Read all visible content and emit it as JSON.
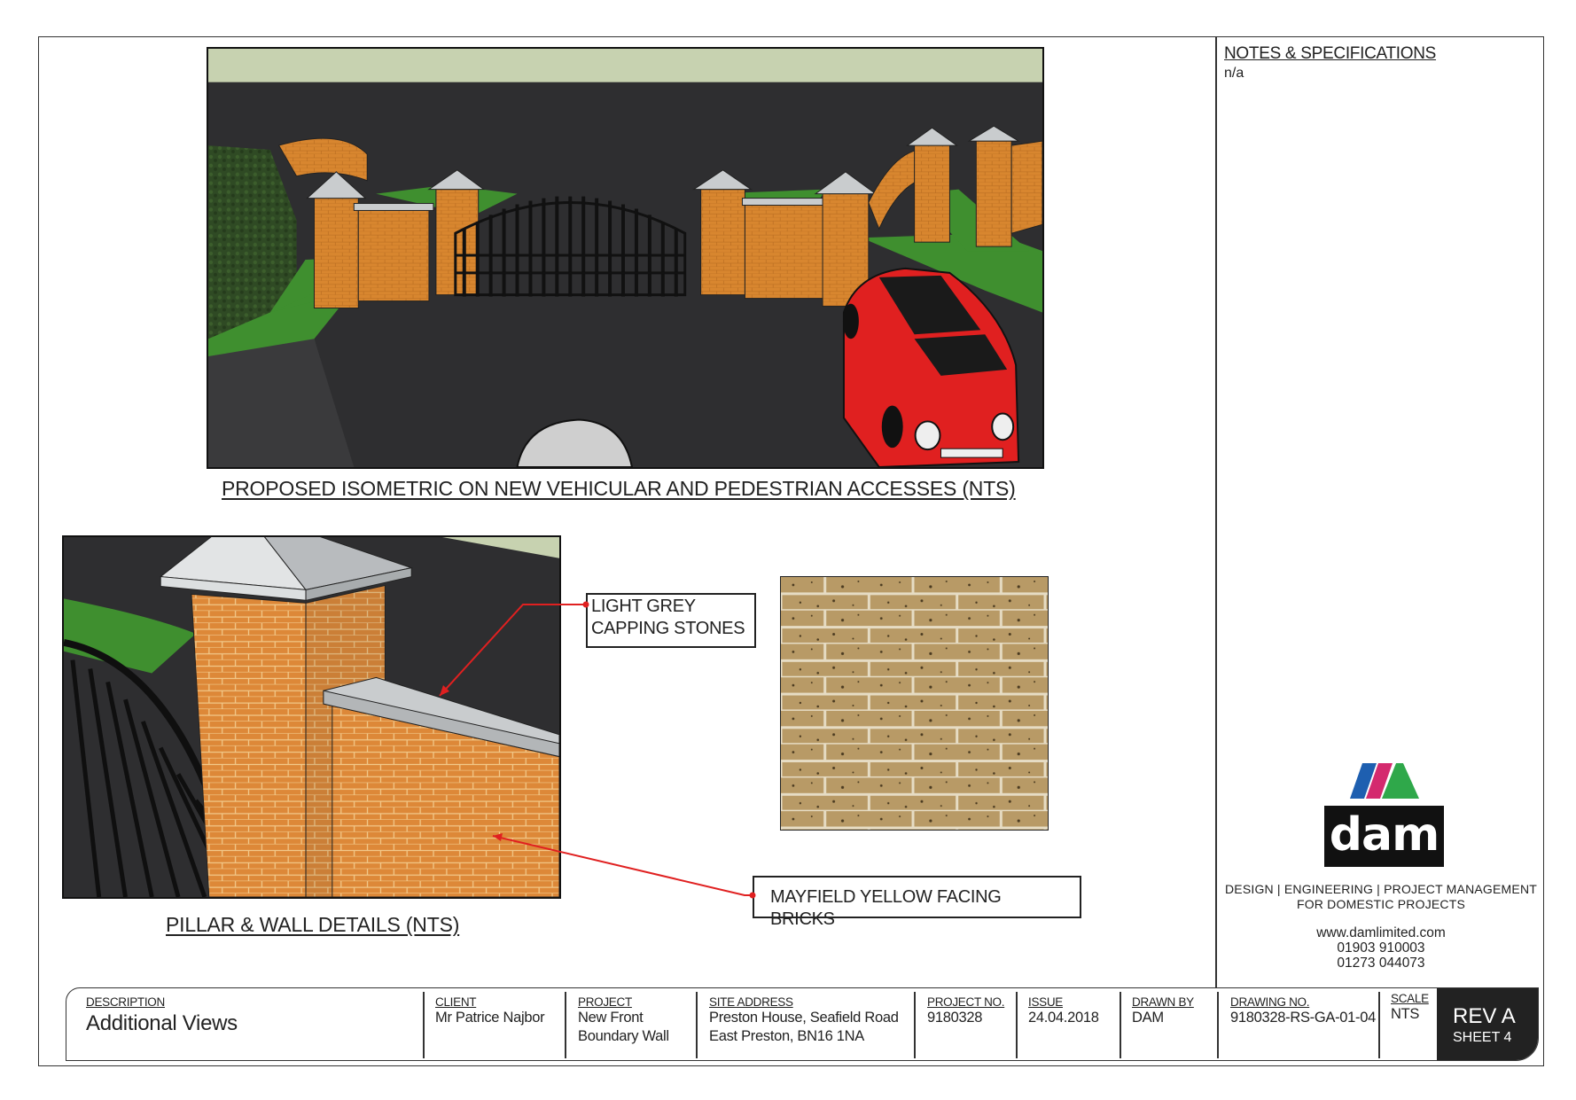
{
  "notes": {
    "title": "NOTES & SPECIFICATIONS",
    "body": "n/a"
  },
  "views": {
    "main_caption": "PROPOSED ISOMETRIC ON NEW VEHICULAR AND PEDESTRIAN ACCESSES (NTS)",
    "detail_caption": "PILLAR & WALL DETAILS (NTS)"
  },
  "callouts": {
    "capping": [
      "LIGHT GREY",
      "CAPPING STONES"
    ],
    "bricks": "MAYFIELD YELLOW FACING BRICKS"
  },
  "company": {
    "logo_text": "dam",
    "tagline": [
      "DESIGN | ENGINEERING | PROJECT MANAGEMENT",
      "FOR DOMESTIC PROJECTS"
    ],
    "website": "www.damlimited.com",
    "phones": [
      "01903 910003",
      "01273 044073"
    ],
    "logo_colors": [
      "#1e5fb0",
      "#d42a6e",
      "#2fa84a"
    ]
  },
  "title_block": {
    "description": {
      "label": "DESCRIPTION",
      "value": "Additional Views"
    },
    "client": {
      "label": "CLIENT",
      "value": "Mr Patrice Najbor"
    },
    "project": {
      "label": "PROJECT",
      "lines": [
        "New Front",
        "Boundary Wall"
      ]
    },
    "site_address": {
      "label": "SITE ADDRESS",
      "lines": [
        "Preston House, Seafield Road",
        "East Preston, BN16 1NA"
      ]
    },
    "project_no": {
      "label": "PROJECT NO.",
      "value": "9180328"
    },
    "issue": {
      "label": "ISSUE",
      "value": "24.04.2018"
    },
    "drawn_by": {
      "label": "DRAWN BY",
      "value": "DAM"
    },
    "drawing_no": {
      "label": "DRAWING NO.",
      "value": "9180328-RS-GA-01-04"
    },
    "scale": {
      "label": "SCALE",
      "value": "NTS"
    },
    "revision": "REV A",
    "sheet": "SHEET 4"
  },
  "colors": {
    "brick": "#d8862f",
    "asphalt": "#2e2e30",
    "grass": "#3f8f2f",
    "capping": "#c9ccce",
    "gate": "#1a1a1a",
    "car_red": "#e02020",
    "facing_brick": "#b89a66",
    "leader_red": "#e02020"
  }
}
